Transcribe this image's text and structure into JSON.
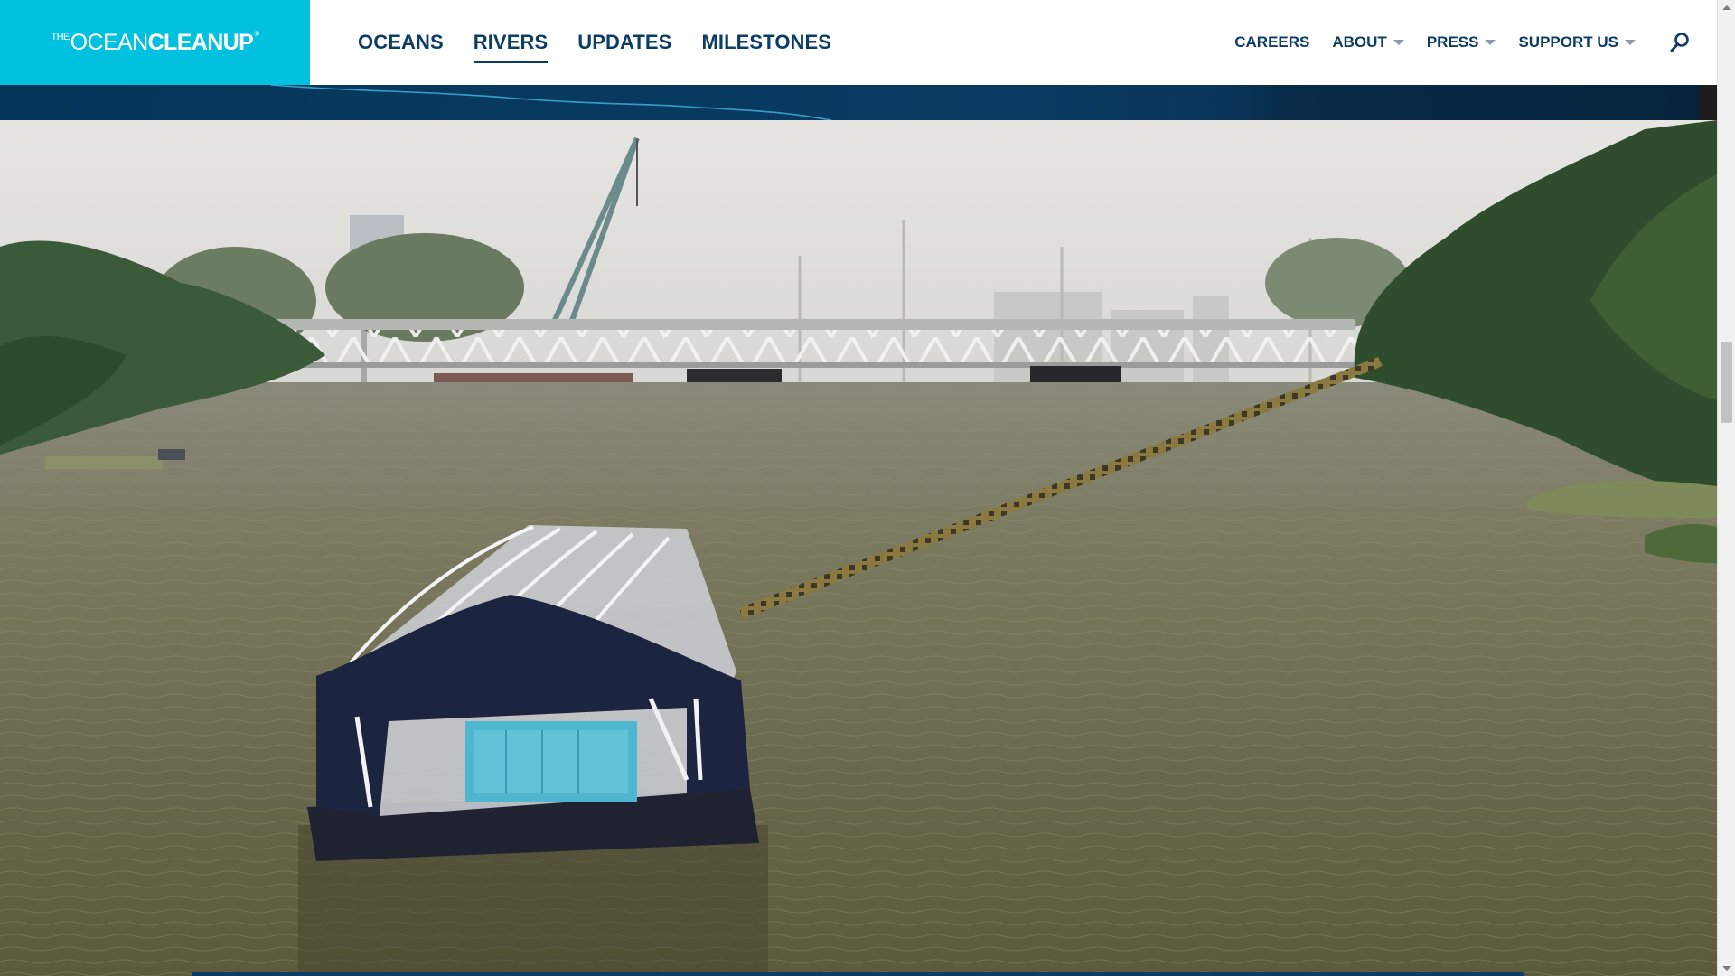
{
  "brand": {
    "logo_prefix": "THE",
    "logo_ocean": "OCEAN",
    "logo_cleanup": "CLEANUP",
    "logo_mark": "®",
    "accent_color": "#00c1e0",
    "nav_color": "#0d3c66"
  },
  "main_nav": {
    "items": [
      {
        "label": "OCEANS"
      },
      {
        "label": "RIVERS",
        "active": true
      },
      {
        "label": "UPDATES"
      },
      {
        "label": "MILESTONES"
      }
    ]
  },
  "secondary_nav": {
    "items": [
      {
        "label": "CAREERS",
        "has_dropdown": false
      },
      {
        "label": "ABOUT",
        "has_dropdown": true
      },
      {
        "label": "PRESS",
        "has_dropdown": true
      },
      {
        "label": "SUPPORT US",
        "has_dropdown": true
      }
    ],
    "search_icon": "search-icon"
  },
  "hero": {
    "image_subject": "interceptor-barge-on-river",
    "icon_names": [
      "interceptor-barge",
      "floating-barrier",
      "truss-bridge",
      "construction-crane"
    ]
  },
  "scrollbar": {
    "up_icon": "arrow-up-icon",
    "down_icon": "arrow-down-icon"
  }
}
